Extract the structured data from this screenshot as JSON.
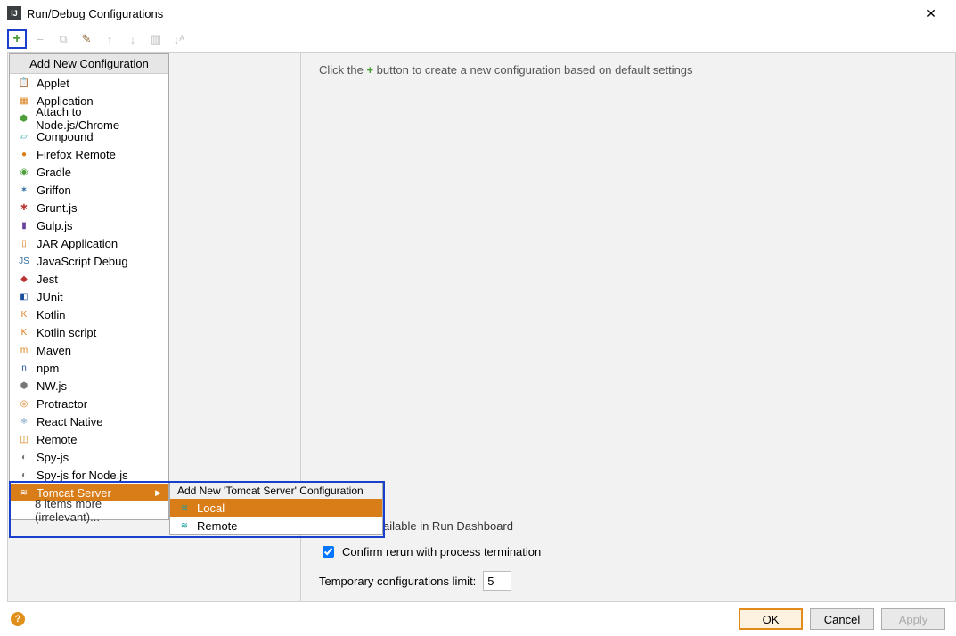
{
  "window": {
    "title": "Run/Debug Configurations"
  },
  "toolbar": {
    "add_tooltip": "Add",
    "remove_tooltip": "Remove",
    "copy_tooltip": "Copy",
    "wrench_tooltip": "Edit",
    "up_tooltip": "Up",
    "down_tooltip": "Down",
    "folder_tooltip": "Folder",
    "sort_tooltip": "Sort"
  },
  "popup": {
    "header": "Add New Configuration",
    "items": [
      {
        "label": "Applet",
        "icon": "📋",
        "cls": "ic-orange"
      },
      {
        "label": "Application",
        "icon": "▦",
        "cls": "ic-orange"
      },
      {
        "label": "Attach to Node.js/Chrome",
        "icon": "⬢",
        "cls": "ic-green"
      },
      {
        "label": "Compound",
        "icon": "▱",
        "cls": "ic-teal"
      },
      {
        "label": "Firefox Remote",
        "icon": "●",
        "cls": "ic-orange"
      },
      {
        "label": "Gradle",
        "icon": "◉",
        "cls": "ic-green"
      },
      {
        "label": "Griffon",
        "icon": "✶",
        "cls": "ic-blue"
      },
      {
        "label": "Grunt.js",
        "icon": "✱",
        "cls": "ic-red"
      },
      {
        "label": "Gulp.js",
        "icon": "▮",
        "cls": "ic-purple"
      },
      {
        "label": "JAR Application",
        "icon": "▯",
        "cls": "ic-orange"
      },
      {
        "label": "JavaScript Debug",
        "icon": "JS",
        "cls": "ic-blue"
      },
      {
        "label": "Jest",
        "icon": "◆",
        "cls": "ic-red"
      },
      {
        "label": "JUnit",
        "icon": "◧",
        "cls": "ic-dblue"
      },
      {
        "label": "Kotlin",
        "icon": "K",
        "cls": "ic-orange"
      },
      {
        "label": "Kotlin script",
        "icon": "K",
        "cls": "ic-orange"
      },
      {
        "label": "Maven",
        "icon": "m",
        "cls": "ic-orange"
      },
      {
        "label": "npm",
        "icon": "n",
        "cls": "ic-dblue"
      },
      {
        "label": "NW.js",
        "icon": "⬢",
        "cls": "ic-gray"
      },
      {
        "label": "Protractor",
        "icon": "◎",
        "cls": "ic-orange"
      },
      {
        "label": "React Native",
        "icon": "⚛",
        "cls": "ic-blue"
      },
      {
        "label": "Remote",
        "icon": "◫",
        "cls": "ic-orange"
      },
      {
        "label": "Spy-js",
        "icon": "◐",
        "cls": "ic-gray"
      },
      {
        "label": "Spy-js for Node.js",
        "icon": "◐",
        "cls": "ic-gray"
      },
      {
        "label": "Tomcat Server",
        "icon": "≋",
        "cls": "",
        "selected": true,
        "arrow": true
      },
      {
        "label": "8 items more (irrelevant)...",
        "more": true
      }
    ]
  },
  "submenu": {
    "header": "Add New 'Tomcat Server' Configuration",
    "items": [
      {
        "label": "Local",
        "icon": "≋",
        "selected": true
      },
      {
        "label": "Remote",
        "icon": "≋"
      }
    ]
  },
  "hint": {
    "prefix": "Click the ",
    "plus": "+",
    "suffix": " button to create a new configuration based on default settings"
  },
  "dashboard_hint_tail": "ailable in Run Dashboard",
  "checkbox_confirm": "Confirm rerun with process termination",
  "temp_label": "Temporary configurations limit:",
  "temp_value": "5",
  "buttons": {
    "ok": "OK",
    "cancel": "Cancel",
    "apply": "Apply"
  }
}
